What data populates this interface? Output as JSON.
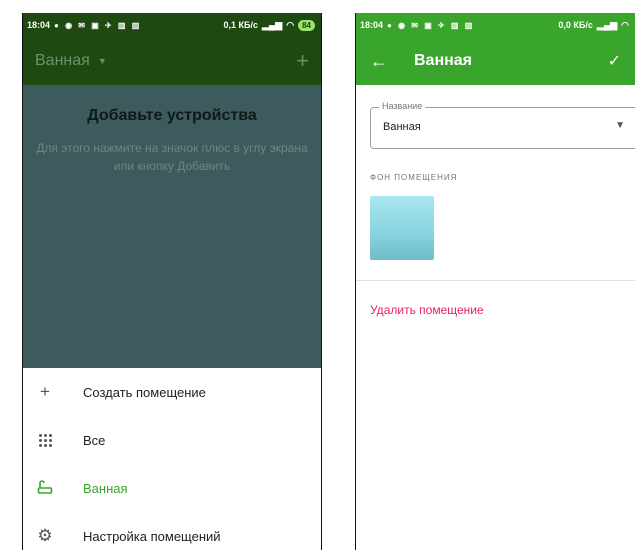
{
  "left": {
    "status": {
      "time": "18:04",
      "speed": "0,1 КБ/с",
      "battery": "84"
    },
    "appbar": {
      "title": "Ванная",
      "add_icon": "plus-icon",
      "dropdown_icon": "caret-down-icon"
    },
    "empty": {
      "heading": "Добавьте устройства",
      "description": "Для этого нажмите на значок плюс в углу экрана или кнопку Добавить"
    },
    "menu": [
      {
        "label": "Создать помещение",
        "icon": "plus-icon"
      },
      {
        "label": "Все",
        "icon": "grid-icon"
      },
      {
        "label": "Ванная",
        "icon": "bathtub-icon",
        "active": true
      },
      {
        "label": "Настройка помещений",
        "icon": "gear-icon"
      }
    ]
  },
  "right": {
    "status": {
      "time": "18:04",
      "speed": "0,0 КБ/с"
    },
    "appbar": {
      "title": "Ванная",
      "back_icon": "arrow-left-icon",
      "confirm_icon": "check-icon"
    },
    "name_field": {
      "legend": "Название",
      "value": "Ванная"
    },
    "background_label": "ФОН ПОМЕЩЕНИЯ",
    "delete_label": "Удалить помещение"
  },
  "colors": {
    "accent_green": "#3aa52d",
    "dark_green": "#1e4a12",
    "delete_pink": "#e91e63",
    "overlay_teal": "#3d5b5c"
  }
}
